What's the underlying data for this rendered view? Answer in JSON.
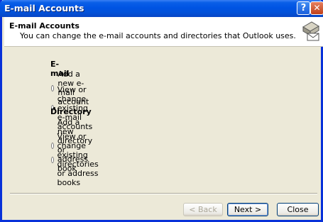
{
  "window": {
    "title": "E-mail Accounts",
    "help_label": "?",
    "close_label": "✕"
  },
  "header": {
    "title": "E-mail Accounts",
    "subtitle": "You can change the e-mail accounts and directories that Outlook uses.",
    "icon": "mail-accounts-icon"
  },
  "email_group": {
    "label": "E-mail",
    "options": [
      {
        "label": "Add a new e-mail account",
        "selected": false
      },
      {
        "label": "View or change existing e-mail accounts",
        "selected": true
      }
    ]
  },
  "directory_group": {
    "label": "Directory",
    "options": [
      {
        "label": "Add a new directory or address book",
        "selected": false
      },
      {
        "label": "View or change existing directories or address books",
        "selected": false
      }
    ]
  },
  "buttons": {
    "back": "< Back",
    "next": "Next >",
    "close": "Close"
  },
  "colors": {
    "titlebar": "#0054e3",
    "dialog_bg": "#ece9d8"
  }
}
